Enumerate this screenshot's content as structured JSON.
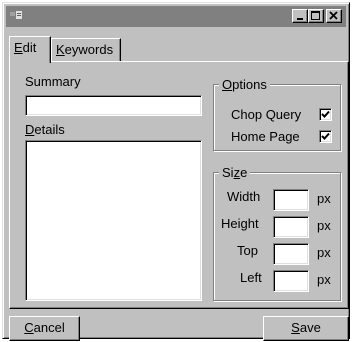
{
  "window": {
    "title": "",
    "minimize_glyph": "_",
    "maximize_glyph": "□",
    "close_glyph": "×"
  },
  "tabs": [
    {
      "label_mnemonic": "E",
      "label_rest": "dit",
      "active": true
    },
    {
      "label_mnemonic": "K",
      "label_rest": "eywords",
      "active": false
    }
  ],
  "summary": {
    "label": "Summary",
    "value": ""
  },
  "details": {
    "label_mnemonic": "D",
    "label_rest": "etails",
    "value": ""
  },
  "options": {
    "title_mnemonic": "O",
    "title_rest": "ptions",
    "chop_query": {
      "label": "Chop Query",
      "checked": true
    },
    "home_page": {
      "label": "Home Page",
      "checked": true
    }
  },
  "size": {
    "title_pre": "Si",
    "title_mnemonic": "z",
    "title_post": "e",
    "unit": "px",
    "fields": [
      {
        "label": "Width",
        "value": ""
      },
      {
        "label": "Height",
        "value": ""
      },
      {
        "label": "Top",
        "value": ""
      },
      {
        "label": "Left",
        "value": ""
      }
    ]
  },
  "buttons": {
    "cancel": {
      "mnemonic": "C",
      "rest": "ancel"
    },
    "save": {
      "mnemonic": "S",
      "rest": "ave"
    }
  }
}
